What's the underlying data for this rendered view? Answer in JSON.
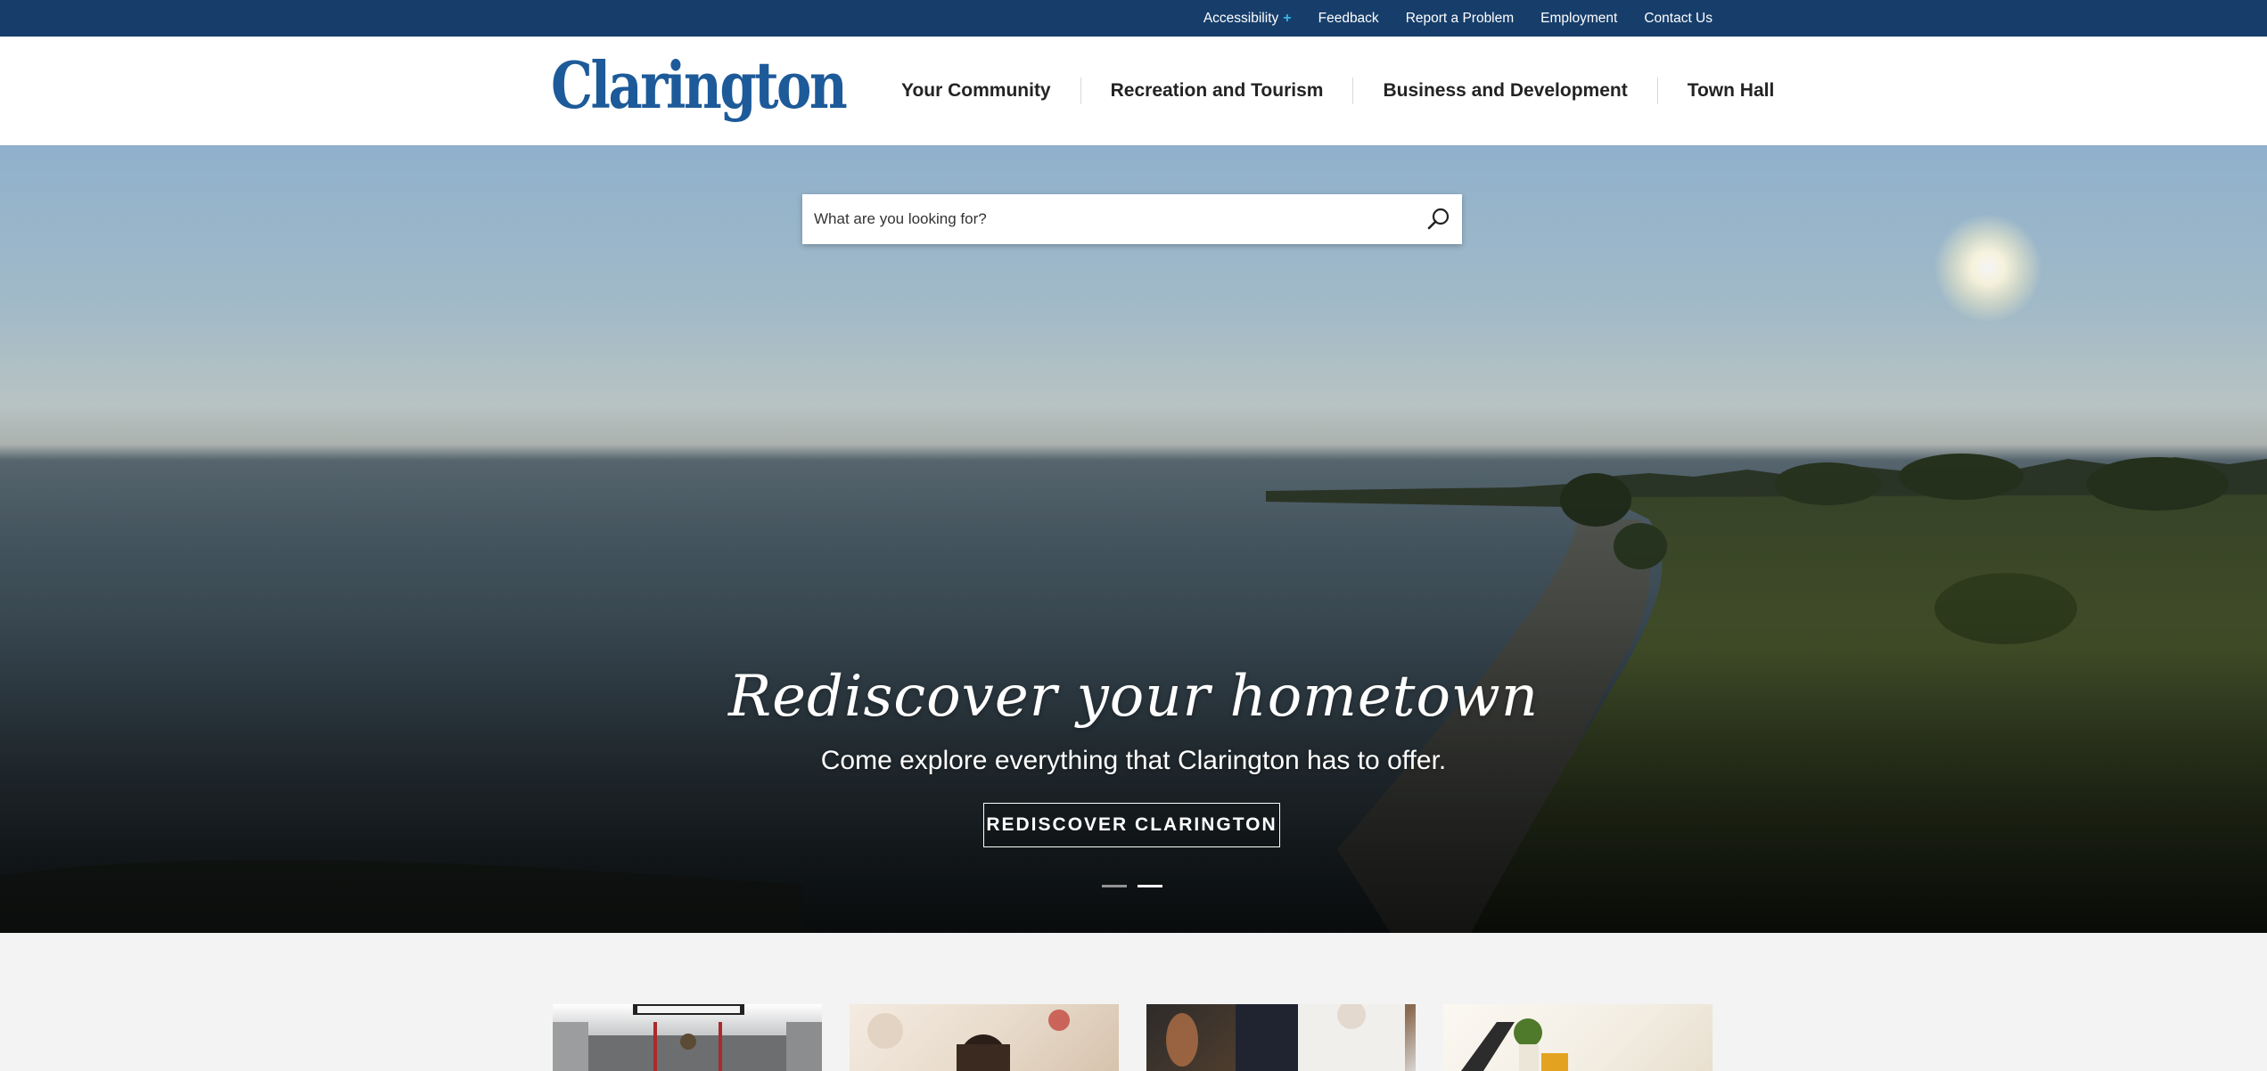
{
  "utility_bar": {
    "links": [
      "Accessibility",
      "Feedback",
      "Report a Problem",
      "Employment",
      "Contact Us"
    ],
    "accessibility_plus": "+"
  },
  "header": {
    "logo_text": "Clarington",
    "nav": [
      "Your Community",
      "Recreation and Tourism",
      "Business and Development",
      "Town Hall"
    ]
  },
  "search": {
    "placeholder": "What are you looking for?",
    "icon": "search-icon"
  },
  "hero": {
    "title": "Rediscover your hometown",
    "subtitle": "Come explore everything that Clarington has to offer.",
    "cta_label": "REDISCOVER CLARINGTON",
    "slide_count": 2,
    "active_slide": 2
  },
  "cards": {
    "count": 4
  },
  "colors": {
    "utility_bar": "#173e6b",
    "logo": "#1d5a99",
    "accent_plus": "#3fb2e6",
    "nav_text": "#232323",
    "page_background": "#f3f3f3"
  }
}
